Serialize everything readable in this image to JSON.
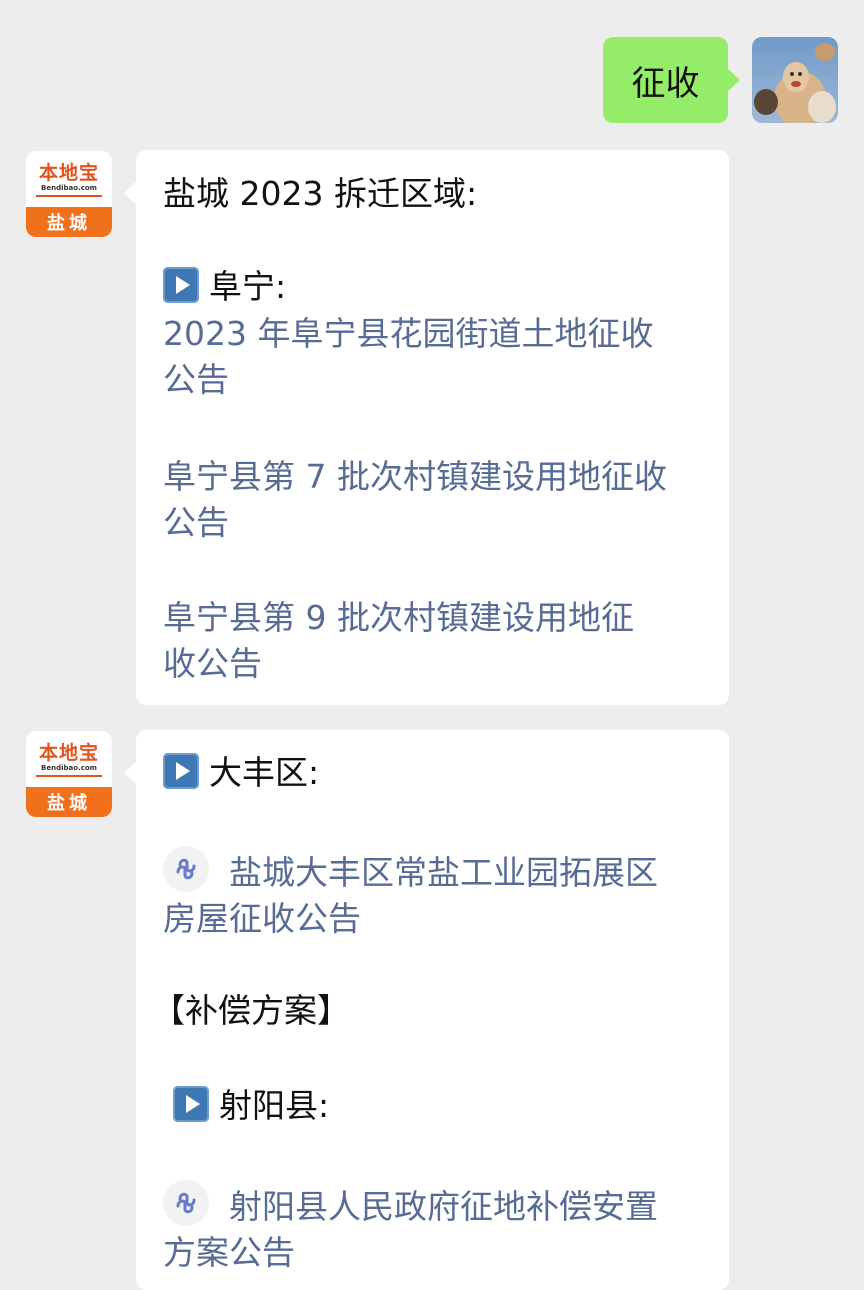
{
  "user_message": {
    "text": "征收",
    "avatar": "user-photo-icon"
  },
  "bot": {
    "avatar": {
      "logo_main": "本地宝",
      "logo_sub": "Bendibao.com",
      "city": "盐城"
    }
  },
  "message1": {
    "title": "盐城 2023 拆迁区域:",
    "section": "阜宁:",
    "links": [
      {
        "line1": "2023 年阜宁县花园街道土地征收",
        "line2": "公告"
      },
      {
        "line1": "阜宁县第 7 批次村镇建设用地征收",
        "line2": "公告"
      },
      {
        "line1": "阜宁县第 9 批次村镇建设用地征",
        "line2": "收公告"
      }
    ]
  },
  "message2": {
    "section1": "大丰区:",
    "link1": {
      "line1": "盐城大丰区常盐工业园拓展区",
      "line2": "房屋征收公告"
    },
    "compensation": "【补偿方案】",
    "section2": "射阳县:",
    "link2": {
      "line1": "射阳县人民政府征地补偿安置",
      "line2": "方案公告"
    }
  },
  "colors": {
    "link": "#576b95",
    "user_bubble": "#95ec69",
    "background": "#ededed",
    "brand_orange": "#f0701c"
  }
}
